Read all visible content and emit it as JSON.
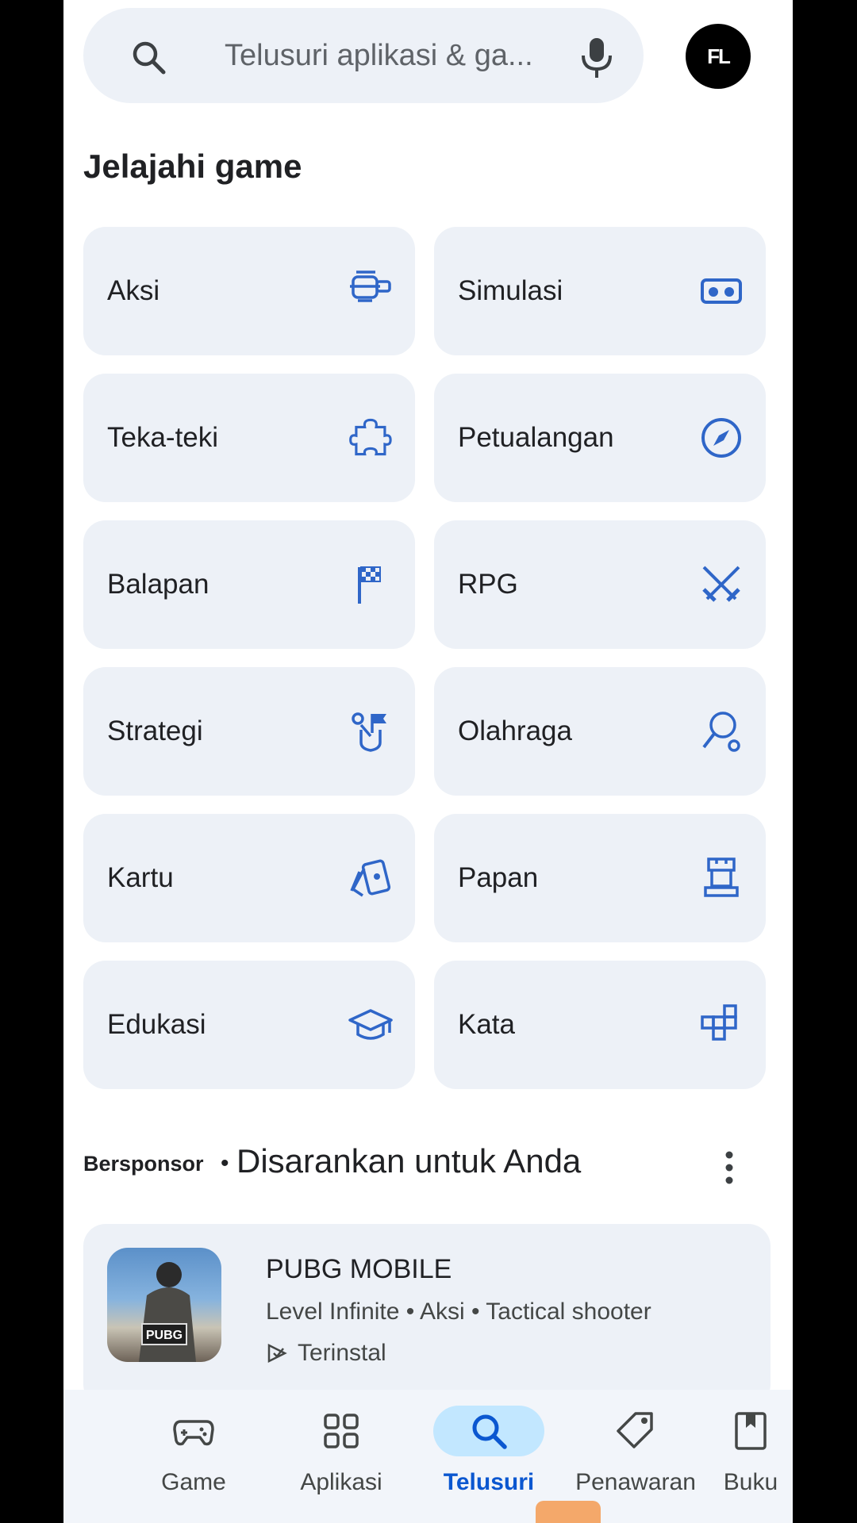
{
  "search": {
    "placeholder": "Telusuri aplikasi & ga..."
  },
  "avatar": {
    "initials": "FL"
  },
  "explore": {
    "title": "Jelajahi game",
    "categories": [
      {
        "label": "Aksi",
        "icon": "action-icon"
      },
      {
        "label": "Simulasi",
        "icon": "vr-headset-icon"
      },
      {
        "label": "Teka-teki",
        "icon": "puzzle-icon"
      },
      {
        "label": "Petualangan",
        "icon": "compass-icon"
      },
      {
        "label": "Balapan",
        "icon": "checkered-flag-icon"
      },
      {
        "label": "RPG",
        "icon": "crossed-swords-icon"
      },
      {
        "label": "Strategi",
        "icon": "strategy-icon"
      },
      {
        "label": "Olahraga",
        "icon": "racket-icon"
      },
      {
        "label": "Kartu",
        "icon": "cards-icon"
      },
      {
        "label": "Papan",
        "icon": "chess-rook-icon"
      },
      {
        "label": "Edukasi",
        "icon": "graduation-cap-icon"
      },
      {
        "label": "Kata",
        "icon": "word-grid-icon"
      }
    ]
  },
  "sponsored": {
    "tag": "Bersponsor",
    "separator": "•",
    "title": "Disarankan untuk Anda"
  },
  "app": {
    "name": "PUBG MOBILE",
    "meta": "Level Infinite • Aksi • Tactical shooter",
    "status": "Terinstal",
    "icon_text": "PUBG"
  },
  "nav": {
    "items": [
      {
        "label": "Game",
        "icon": "gamepad-icon"
      },
      {
        "label": "Aplikasi",
        "icon": "apps-grid-icon"
      },
      {
        "label": "Telusuri",
        "icon": "search-icon",
        "active": true
      },
      {
        "label": "Penawaran",
        "icon": "tag-icon"
      },
      {
        "label": "Buku",
        "icon": "bookmark-book-icon"
      }
    ]
  },
  "colors": {
    "accent": "#0b57d0",
    "icon_blue": "#2f66c8",
    "tile_bg": "#edf1f7",
    "active_pill": "#c2e7ff"
  }
}
